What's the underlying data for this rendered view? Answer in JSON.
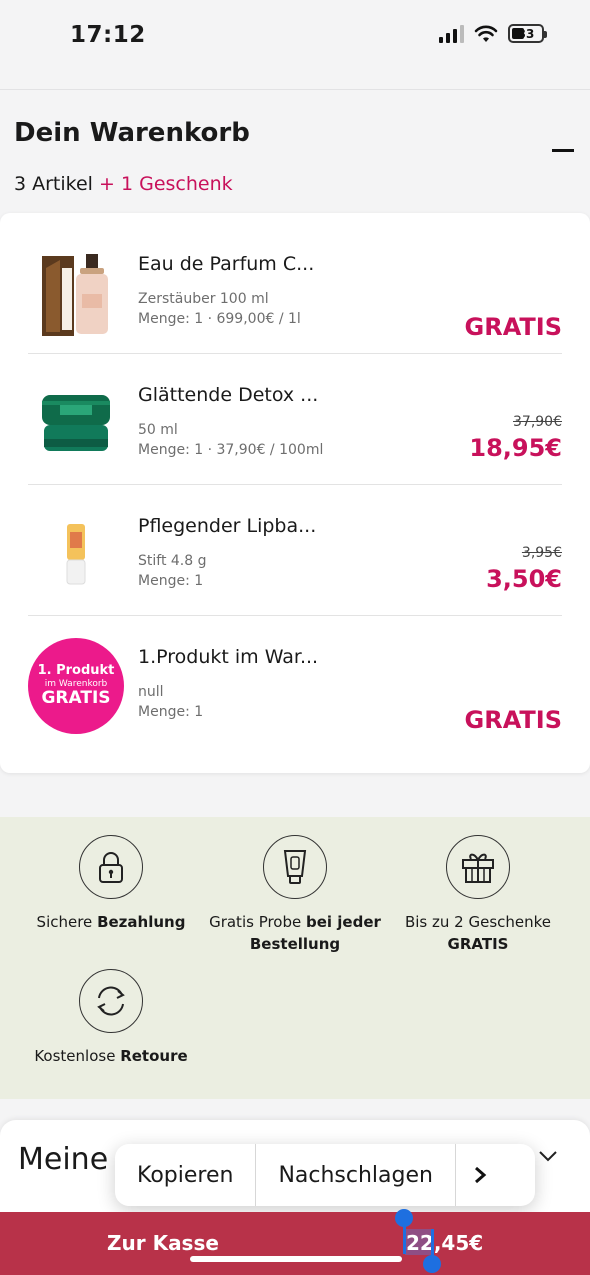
{
  "status_bar": {
    "time": "17:12",
    "battery": "33"
  },
  "cart": {
    "title": "Dein Warenkorb",
    "count": "3 Artikel",
    "gift": "+ 1 Geschenk"
  },
  "items": [
    {
      "name": "Eau de Parfum C...",
      "meta1": "Zerstäuber 100 ml",
      "meta2": "Menge: 1 · 699,00€ / 1l",
      "old_price": "",
      "price": "GRATIS",
      "thumb": "perfume-bottle"
    },
    {
      "name": "Glättende Detox ...",
      "meta1": "50 ml",
      "meta2": "Menge: 1 · 37,90€ / 100ml",
      "old_price": "37,90€",
      "price": "18,95€",
      "thumb": "cream-jar"
    },
    {
      "name": "Pflegender Lipba...",
      "meta1": "Stift 4.8 g",
      "meta2": "Menge: 1",
      "old_price": "3,95€",
      "price": "3,50€",
      "thumb": "lip-balm"
    },
    {
      "name": "1.Produkt im War...",
      "meta1": "null",
      "meta2": "Menge: 1",
      "old_price": "",
      "price": "GRATIS",
      "thumb": "promo-badge"
    }
  ],
  "promo_badge": {
    "line1": "1. Produkt",
    "line2": "im Warenkorb",
    "line3": "GRATIS"
  },
  "benefits": [
    {
      "icon": "lock-icon",
      "text_a": "Sichere ",
      "text_b": "Bezahlung"
    },
    {
      "icon": "tube-icon",
      "text_a": "Gratis Probe ",
      "text_b": "bei jeder Bestellung"
    },
    {
      "icon": "gift-icon",
      "text_a": "Bis zu 2 Geschenke ",
      "text_b": "GRATIS"
    },
    {
      "icon": "refresh-icon",
      "text_a": "Kostenlose ",
      "text_b": "Retoure"
    }
  ],
  "order_summary": {
    "title": "Meine"
  },
  "context_menu": {
    "copy": "Kopieren",
    "lookup": "Nachschlagen",
    "more": "›"
  },
  "checkout": {
    "label": "Zur Kasse",
    "total": "22,45€"
  },
  "colors": {
    "accent": "#c8115b",
    "checkout_bar": "#b83249",
    "benefits_bg": "#ebeee1"
  }
}
